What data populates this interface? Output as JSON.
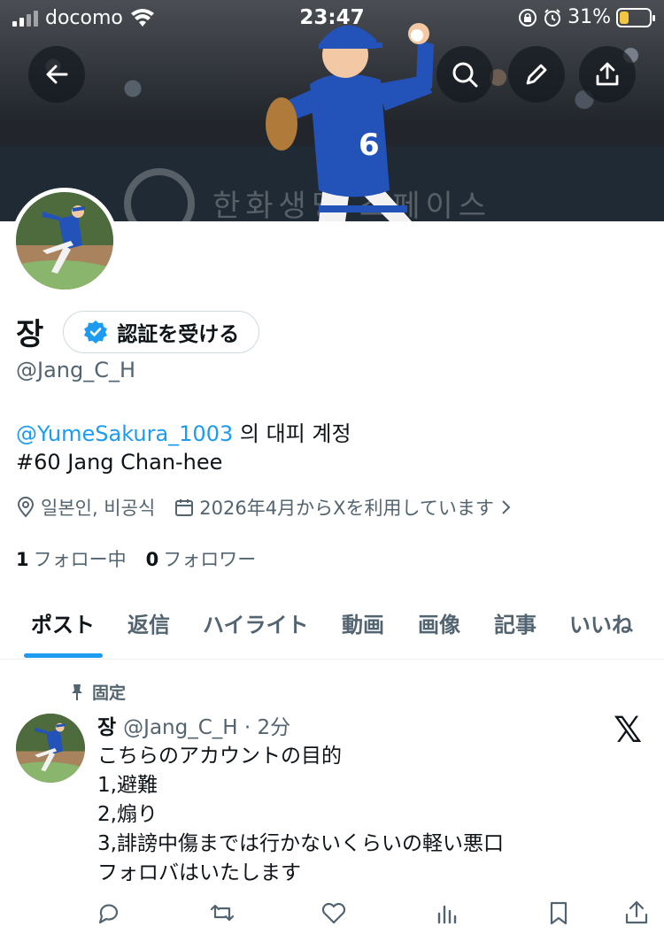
{
  "status_bar": {
    "carrier": "docomo",
    "time": "23:47",
    "battery_percent": "31%",
    "battery_level": 0.31
  },
  "header_buttons": {
    "back_icon": "arrow-left-icon",
    "search_icon": "search-icon",
    "edit_icon": "pencil-icon",
    "share_icon": "share-icon"
  },
  "banner": {
    "wall_text": "한화생명 스페이스"
  },
  "profile": {
    "display_name": "장",
    "verify_label": "認証を受ける",
    "handle": "@Jang_C_H",
    "bio_mention": "@YumeSakura_1003",
    "bio_line1_rest": " 의 대피 계정",
    "bio_line2": "#60 Jang Chan-hee",
    "location": "일본인, 비공식",
    "joined": "2026年4月からXを利用しています",
    "following_count": "1",
    "following_label": "フォロー中",
    "followers_count": "0",
    "followers_label": "フォロワー"
  },
  "tabs": [
    "ポスト",
    "返信",
    "ハイライト",
    "動画",
    "画像",
    "記事",
    "いいね"
  ],
  "post": {
    "pinned_label": "固定",
    "author_name": "장",
    "author_handle_time": "@Jang_C_H · 2分",
    "lines": [
      "こちらのアカウントの目的",
      "1,避難",
      "2,煽り",
      "3,誹謗中傷までは行かないくらいの軽い悪口",
      "フォロバはいたします"
    ],
    "x_logo": "𝕏"
  },
  "colors": {
    "accent": "#1d9bf0",
    "text": "#0f1419",
    "muted": "#536471",
    "jersey_blue": "#2352b8"
  }
}
